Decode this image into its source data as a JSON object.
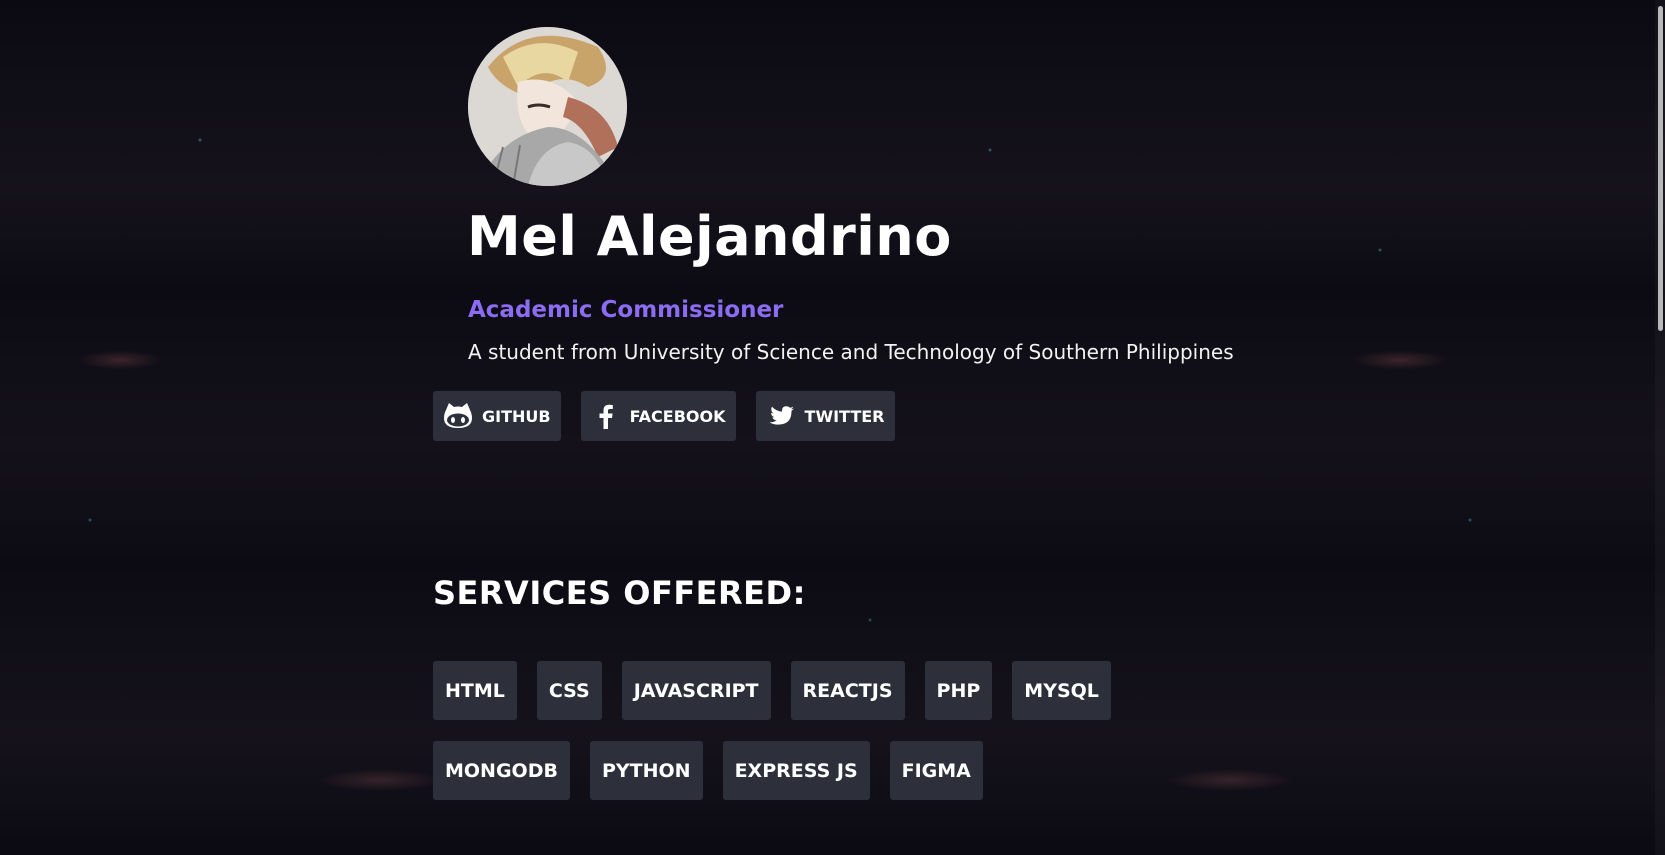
{
  "profile": {
    "name": "Mel Alejandrino",
    "role": "Academic Commissioner",
    "bio": "A student from University of Science and Technology of Southern Philippines"
  },
  "social": [
    {
      "label": "GITHUB",
      "icon": "github-icon"
    },
    {
      "label": "FACEBOOK",
      "icon": "facebook-icon"
    },
    {
      "label": "TWITTER",
      "icon": "twitter-icon"
    }
  ],
  "services": {
    "title": "SERVICES OFFERED:",
    "skills": [
      "HTML",
      "CSS",
      "JAVASCRIPT",
      "REACTJS",
      "PHP",
      "MYSQL",
      "MONGODB",
      "PYTHON",
      "EXPRESS JS",
      "FIGMA"
    ]
  },
  "colors": {
    "accent": "#8b6cf2",
    "button_bg": "#2d303a",
    "page_bg": "#0b0a12",
    "text": "#ffffff"
  }
}
